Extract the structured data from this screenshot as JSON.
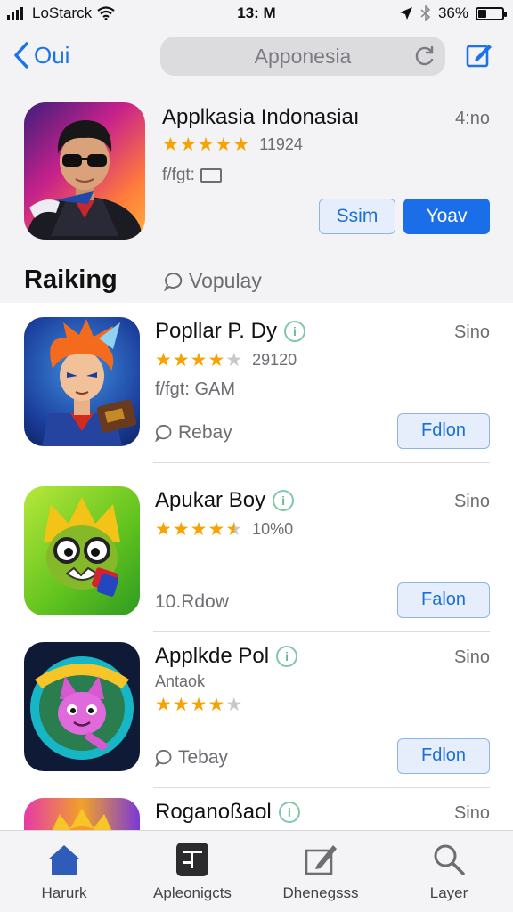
{
  "status_bar": {
    "carrier": "LoStarck",
    "time": "13: M",
    "battery_percent": "36%",
    "battery_level": 0.36
  },
  "nav": {
    "back_label": "Oui",
    "search_value": "Apponesia"
  },
  "featured": {
    "title": "Applkasia Indonasiaı",
    "price": "4:no",
    "rating_count": "11924",
    "meta": "f/fgt:",
    "buttons": {
      "secondary": "Ssim",
      "primary": "Yoav"
    }
  },
  "ranking": {
    "title": "Raiking",
    "popular_label": "Vopulay"
  },
  "apps": [
    {
      "title": "Popllar P. Dy",
      "price": "Sino",
      "rating_count": "29120",
      "subtitle": "f/fgt: GAM",
      "footer": "Rebay",
      "button": "Fdlon",
      "stars": 4,
      "icon": "hero-character-icon"
    },
    {
      "title": "Apukar Boy",
      "price": "Sino",
      "rating_count": "10%0",
      "subtitle": "",
      "footer": "10.Rdow",
      "button": "Falon",
      "stars": 4.5,
      "icon": "monster-character-icon"
    },
    {
      "title": "Applkde Pol",
      "price": "Sino",
      "rating_count": "",
      "subtitle": "Antaok",
      "footer": "Tebay",
      "button": "Fdlon",
      "stars": 4,
      "icon": "cat-badge-icon"
    },
    {
      "title": "Roganoßaol",
      "price": "Sino",
      "icon": "sun-character-icon"
    }
  ],
  "tabs": [
    {
      "label": "Harurk",
      "icon": "home-icon"
    },
    {
      "label": "Apleonigcts",
      "icon": "apps-icon"
    },
    {
      "label": "Dhenegsss",
      "icon": "updates-icon"
    },
    {
      "label": "Layer",
      "icon": "search-icon"
    }
  ],
  "colors": {
    "accent": "#1a6fe8",
    "star": "#f6a300",
    "info": "#6cb996"
  }
}
